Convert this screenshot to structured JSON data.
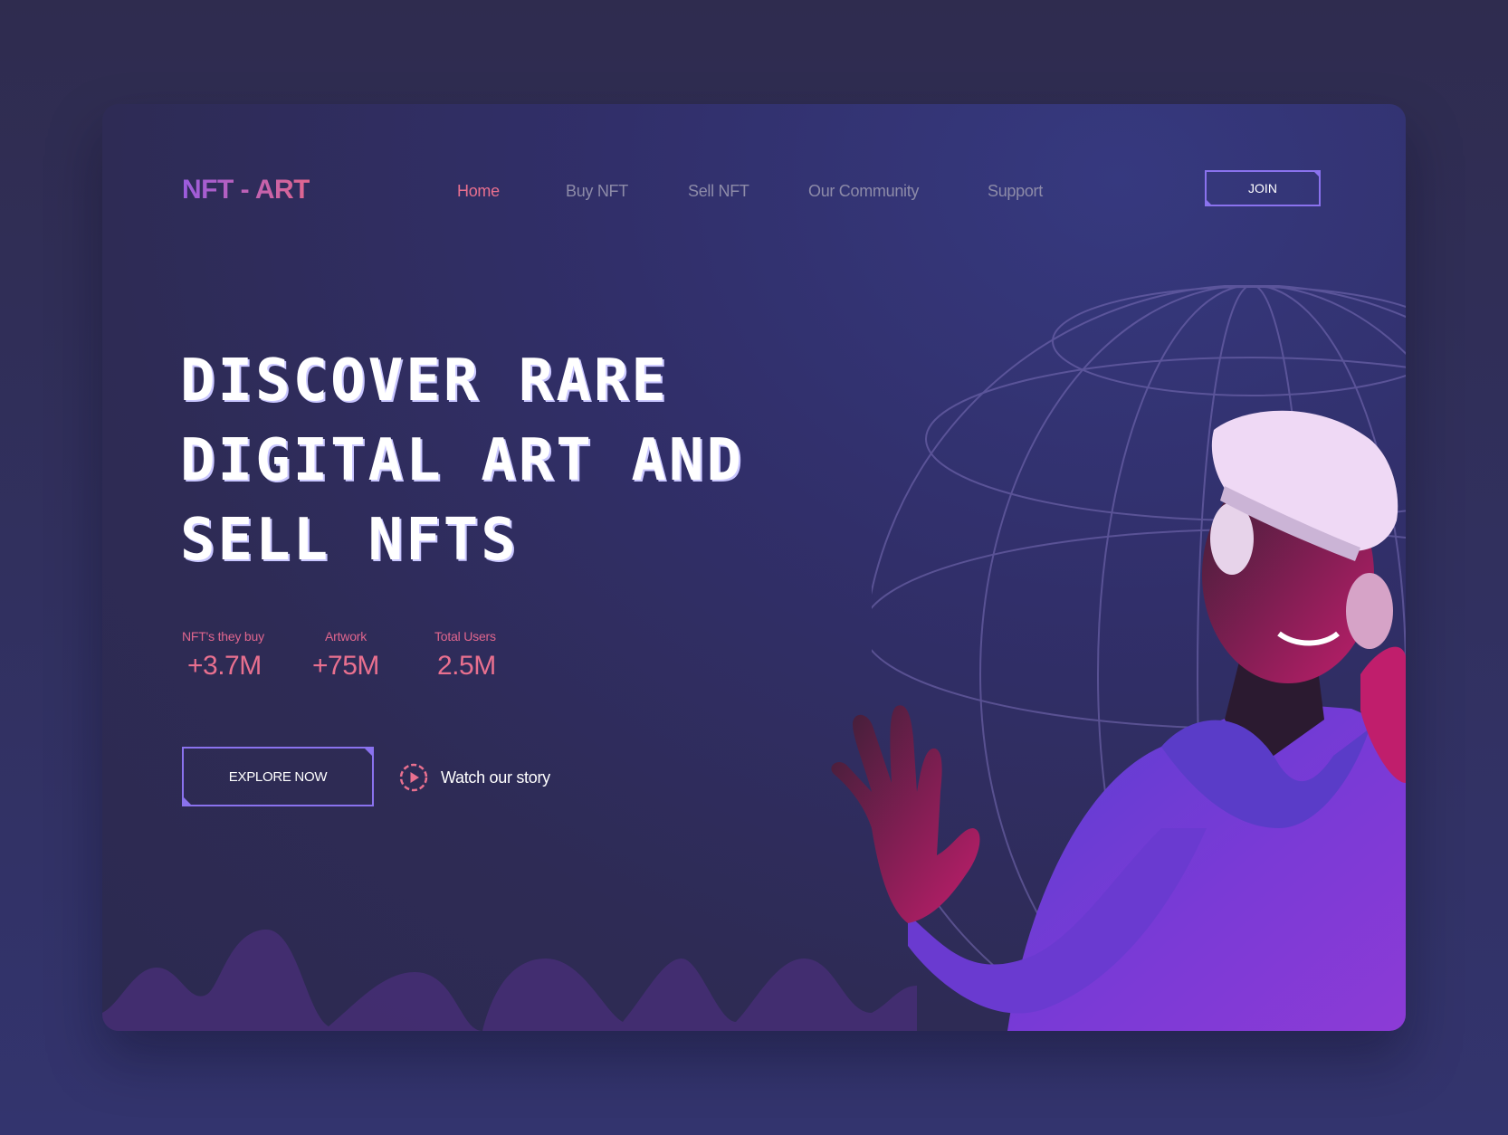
{
  "brand": {
    "logo": "NFT - ART"
  },
  "nav": {
    "items": [
      {
        "label": "Home",
        "active": true
      },
      {
        "label": "Buy NFT",
        "active": false
      },
      {
        "label": "Sell NFT",
        "active": false
      },
      {
        "label": "Our Community",
        "active": false
      },
      {
        "label": "Support",
        "active": false
      }
    ],
    "join_label": "JOIN"
  },
  "hero": {
    "headline_lines": [
      "DISCOVER RARE",
      "DIGITAL ART AND",
      "SELL NFTS"
    ],
    "stats": [
      {
        "label": "NFT's they buy",
        "value": "+3.7M"
      },
      {
        "label": "Artwork",
        "value": "+75M"
      },
      {
        "label": "Total Users",
        "value": "2.5M"
      }
    ],
    "explore_label": "EXPLORE NOW",
    "watch_label": "Watch our story"
  },
  "colors": {
    "accent_pink": "#e9708f",
    "accent_purple": "#8a72ee",
    "background": "#2e2b55"
  },
  "icons": {
    "play": "play-circle-icon"
  }
}
